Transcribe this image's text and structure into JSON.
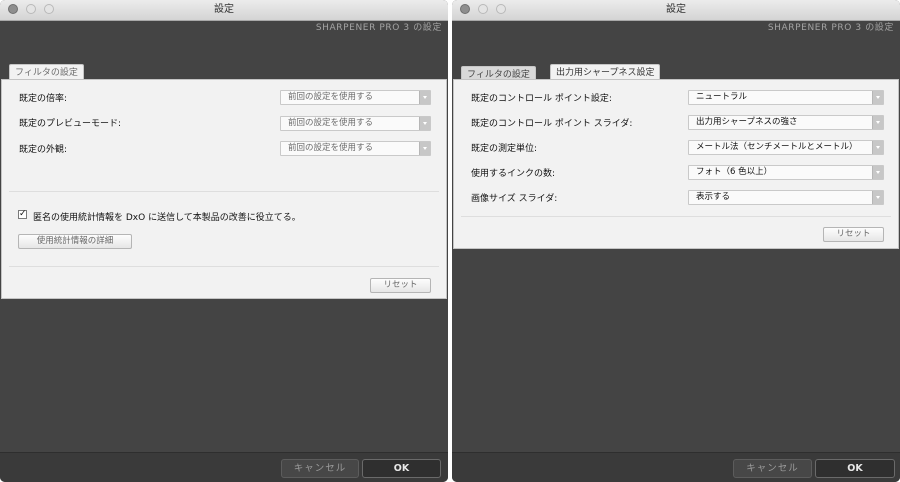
{
  "left_window": {
    "title": "設定",
    "brand": "SHARPENER PRO 3 の設定",
    "tabs": [
      {
        "label": "フィルタの設定",
        "active": true
      }
    ],
    "settings": [
      {
        "label": "既定の倍率:",
        "value": "前回の設定を使用する"
      },
      {
        "label": "既定のプレビューモード:",
        "value": "前回の設定を使用する"
      },
      {
        "label": "既定の外観:",
        "value": "前回の設定を使用する"
      }
    ],
    "checkbox": {
      "checked": true,
      "label": "匿名の使用統計情報を DxO に送信して本製品の改善に役立てる。"
    },
    "details_button": "使用統計情報の詳細",
    "reset_button": "リセット",
    "cancel_button": "キャンセル",
    "ok_button": "OK"
  },
  "right_window": {
    "title": "設定",
    "brand": "SHARPENER PRO 3 の設定",
    "tabs": [
      {
        "label": "フィルタの設定",
        "active": false
      },
      {
        "label": "出力用シャープネス設定",
        "active": true
      }
    ],
    "settings": [
      {
        "label": "既定のコントロール ポイント設定:",
        "value": "ニュートラル"
      },
      {
        "label": "既定のコントロール ポイント スライダ:",
        "value": "出力用シャープネスの強さ"
      },
      {
        "label": "既定の測定単位:",
        "value": "メートル法（センチメートルとメートル）"
      },
      {
        "label": "使用するインクの数:",
        "value": "フォト（6 色以上）"
      },
      {
        "label": "画像サイズ スライダ:",
        "value": "表示する"
      }
    ],
    "reset_button": "リセット",
    "cancel_button": "キャンセル",
    "ok_button": "OK"
  },
  "colors": {
    "window_background": "#444444",
    "panel_background": "#f2f2f2",
    "footer_background": "#3a3a3a"
  }
}
